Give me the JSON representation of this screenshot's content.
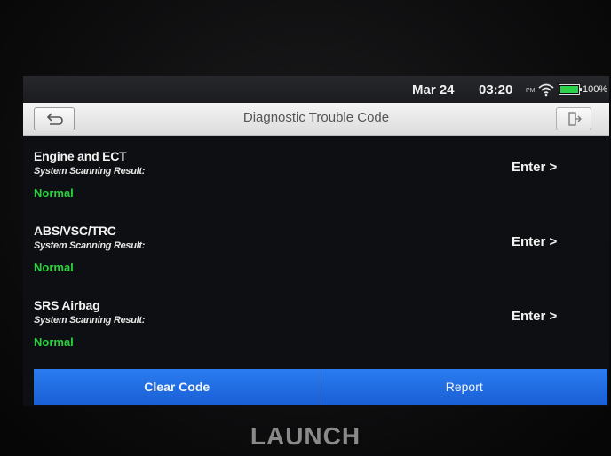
{
  "status_bar": {
    "date": "Mar 24",
    "time": "03:20",
    "ampm": "PM",
    "battery_label": "100%",
    "battery_level": 1.0,
    "battery_color": "#2bd24a"
  },
  "header": {
    "title": "Diagnostic Trouble Code",
    "back_icon": "back-arrow-icon",
    "exit_icon": "exit-icon"
  },
  "systems": [
    {
      "name": "Engine and ECT",
      "subtitle": "System Scanning Result:",
      "status": "Normal",
      "enter_label": "Enter >"
    },
    {
      "name": "ABS/VSC/TRC",
      "subtitle": "System Scanning Result:",
      "status": "Normal",
      "enter_label": "Enter >"
    },
    {
      "name": "SRS Airbag",
      "subtitle": "System Scanning Result:",
      "status": "Normal",
      "enter_label": "Enter >"
    }
  ],
  "footer": {
    "clear_code_label": "Clear Code",
    "report_label": "Report",
    "accent_color": "#1f6fe6"
  },
  "device": {
    "brand": "LAUNCH"
  }
}
